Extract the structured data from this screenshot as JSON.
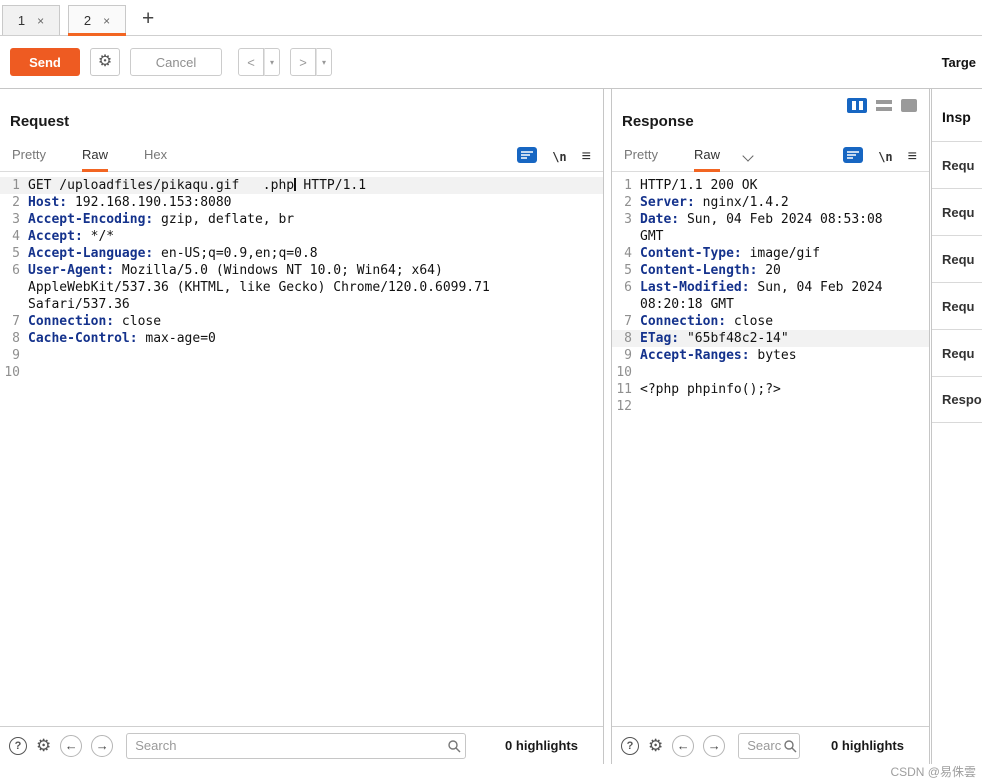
{
  "tab_bar": {
    "tabs": [
      {
        "label": "1",
        "close": "×"
      },
      {
        "label": "2",
        "close": "×"
      }
    ],
    "new_tab": "+"
  },
  "toolbar": {
    "send": "Send",
    "cancel": "Cancel",
    "back": "<",
    "forward": ">",
    "caret": "▾",
    "target": "Targe"
  },
  "icons": {
    "gear": "⚙",
    "help": "?",
    "prev": "←",
    "next": "→",
    "menu": "≡",
    "newline": "\\n"
  },
  "request": {
    "title": "Request",
    "tabs": [
      "Pretty",
      "Raw",
      "Hex"
    ],
    "active_tab": "Raw",
    "search": {
      "placeholder": "Search",
      "highlights": "0 highlights"
    },
    "lines": [
      {
        "num": "1",
        "hl": true,
        "segs": [
          {
            "c": "plain",
            "t": "GET /uploadfiles/pikaqu.gif   .php"
          },
          {
            "cursor": true
          },
          {
            "c": "plain",
            "t": " HTTP/1.1"
          }
        ]
      },
      {
        "num": "2",
        "segs": [
          {
            "c": "name",
            "t": "Host:"
          },
          {
            "c": "plain",
            "t": " 192.168.190.153:8080"
          }
        ]
      },
      {
        "num": "3",
        "segs": [
          {
            "c": "name",
            "t": "Accept-Encoding:"
          },
          {
            "c": "plain",
            "t": " gzip, deflate, br"
          }
        ]
      },
      {
        "num": "4",
        "segs": [
          {
            "c": "name",
            "t": "Accept:"
          },
          {
            "c": "plain",
            "t": " */*"
          }
        ]
      },
      {
        "num": "5",
        "segs": [
          {
            "c": "name",
            "t": "Accept-Language:"
          },
          {
            "c": "plain",
            "t": " en-US;q=0.9,en;q=0.8"
          }
        ]
      },
      {
        "num": "6",
        "segs": [
          {
            "c": "name",
            "t": "User-Agent:"
          },
          {
            "c": "plain",
            "t": " Mozilla/5.0 (Windows NT 10.0; Win64; x64) AppleWebKit/537.36 (KHTML, like Gecko) Chrome/120.0.6099.71 Safari/537.36"
          }
        ]
      },
      {
        "num": "7",
        "segs": [
          {
            "c": "name",
            "t": "Connection:"
          },
          {
            "c": "plain",
            "t": " close"
          }
        ]
      },
      {
        "num": "8",
        "segs": [
          {
            "c": "name",
            "t": "Cache-Control:"
          },
          {
            "c": "plain",
            "t": " max-age=0"
          }
        ]
      },
      {
        "num": "9",
        "segs": []
      },
      {
        "num": "10",
        "segs": []
      }
    ]
  },
  "response": {
    "title": "Response",
    "tabs": [
      "Pretty",
      "Raw"
    ],
    "active_tab": "Raw",
    "search": {
      "placeholder": "Search",
      "highlights": "0 highlights"
    },
    "lines": [
      {
        "num": "1",
        "segs": [
          {
            "c": "plain",
            "t": "HTTP/1.1 200 OK"
          }
        ]
      },
      {
        "num": "2",
        "segs": [
          {
            "c": "name",
            "t": "Server:"
          },
          {
            "c": "plain",
            "t": " nginx/1.4.2"
          }
        ]
      },
      {
        "num": "3",
        "segs": [
          {
            "c": "name",
            "t": "Date:"
          },
          {
            "c": "plain",
            "t": " Sun, 04 Feb 2024 08:53:08 GMT"
          }
        ]
      },
      {
        "num": "4",
        "segs": [
          {
            "c": "name",
            "t": "Content-Type:"
          },
          {
            "c": "plain",
            "t": " image/gif"
          }
        ]
      },
      {
        "num": "5",
        "segs": [
          {
            "c": "name",
            "t": "Content-Length:"
          },
          {
            "c": "plain",
            "t": " 20"
          }
        ]
      },
      {
        "num": "6",
        "segs": [
          {
            "c": "name",
            "t": "Last-Modified:"
          },
          {
            "c": "plain",
            "t": " Sun, 04 Feb 2024 08:20:18 GMT"
          }
        ]
      },
      {
        "num": "7",
        "segs": [
          {
            "c": "name",
            "t": "Connection:"
          },
          {
            "c": "plain",
            "t": " close"
          }
        ]
      },
      {
        "num": "8",
        "hl": true,
        "segs": [
          {
            "c": "name",
            "t": "ETag:"
          },
          {
            "c": "plain",
            "t": " \"65bf48c2-14\""
          }
        ]
      },
      {
        "num": "9",
        "segs": [
          {
            "c": "name",
            "t": "Accept-Ranges:"
          },
          {
            "c": "plain",
            "t": " bytes"
          }
        ]
      },
      {
        "num": "10",
        "segs": []
      },
      {
        "num": "11",
        "segs": [
          {
            "c": "plain",
            "t": "<?php phpinfo();?>"
          }
        ]
      },
      {
        "num": "12",
        "segs": []
      }
    ]
  },
  "inspector": {
    "title": "Insp",
    "sections": [
      "Requ",
      "Requ",
      "Requ",
      "Requ",
      "Requ",
      "Respo"
    ]
  },
  "watermark": "CSDN @易侏雲"
}
